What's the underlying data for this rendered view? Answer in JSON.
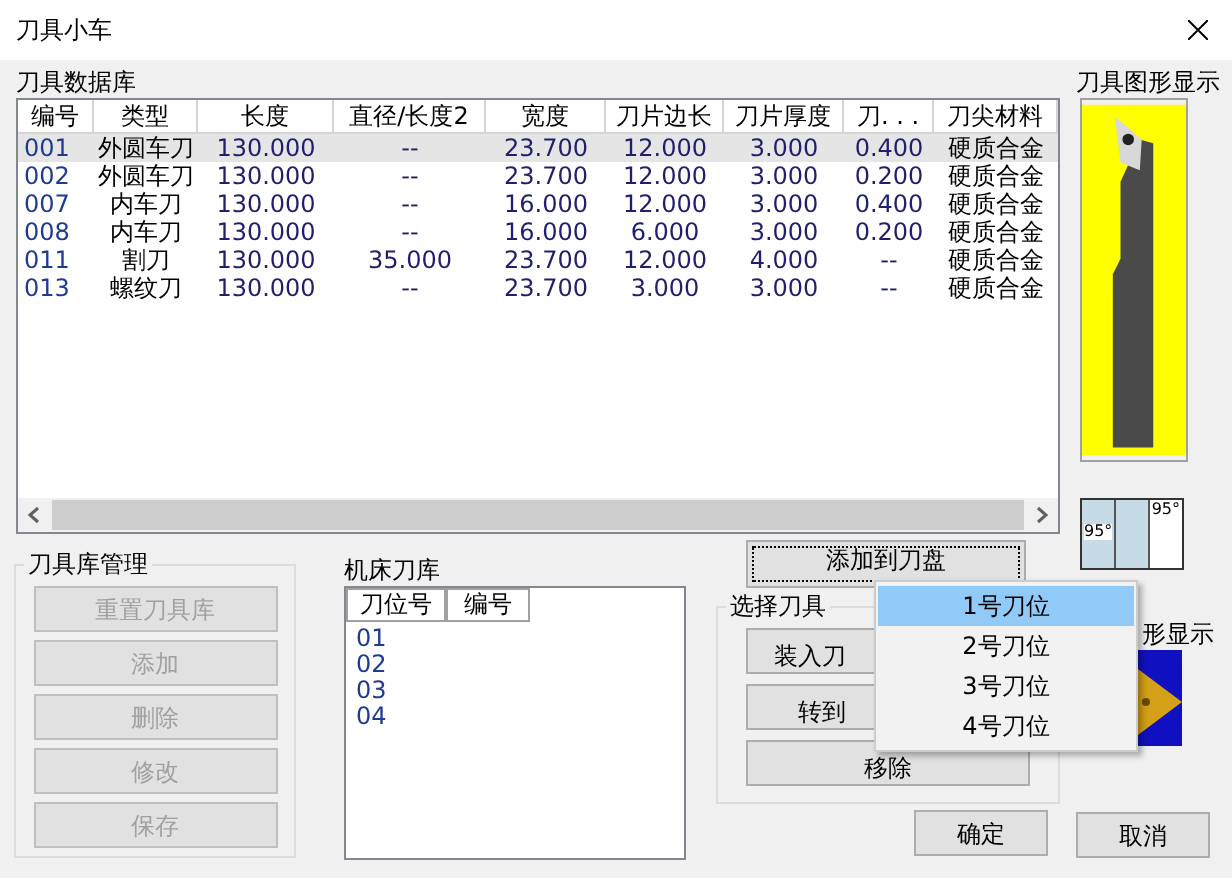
{
  "window": {
    "title": "刀具小车"
  },
  "tool_database": {
    "label": "刀具数据库",
    "columns": [
      "编号",
      "类型",
      "长度",
      "直径/长度2",
      "宽度",
      "刀片边长",
      "刀片厚度",
      "刀. . .",
      "刀尖材料"
    ],
    "rows": [
      {
        "cells": [
          "001",
          "外圆车刀",
          "130.000",
          "--",
          "23.700",
          "12.000",
          "3.000",
          "0.400",
          "硬质合金"
        ],
        "selected": true
      },
      {
        "cells": [
          "002",
          "外圆车刀",
          "130.000",
          "--",
          "23.700",
          "12.000",
          "3.000",
          "0.200",
          "硬质合金"
        ],
        "selected": false
      },
      {
        "cells": [
          "007",
          "内车刀",
          "130.000",
          "--",
          "16.000",
          "12.000",
          "3.000",
          "0.400",
          "硬质合金"
        ],
        "selected": false
      },
      {
        "cells": [
          "008",
          "内车刀",
          "130.000",
          "--",
          "16.000",
          "6.000",
          "3.000",
          "0.200",
          "硬质合金"
        ],
        "selected": false
      },
      {
        "cells": [
          "011",
          "割刀",
          "130.000",
          "35.000",
          "23.700",
          "12.000",
          "4.000",
          "--",
          "硬质合金"
        ],
        "selected": false
      },
      {
        "cells": [
          "013",
          "螺纹刀",
          "130.000",
          "--",
          "23.700",
          "3.000",
          "3.000",
          "--",
          "硬质合金"
        ],
        "selected": false
      }
    ]
  },
  "tool_preview": {
    "label": "刀具图形显示"
  },
  "holder_icon": {
    "angles": [
      "95°",
      "95°"
    ]
  },
  "insert_preview": {
    "label": "形显示"
  },
  "library_management": {
    "label": "刀具库管理",
    "buttons": [
      {
        "label": "重置刀具库",
        "disabled": true
      },
      {
        "label": "添加",
        "disabled": true
      },
      {
        "label": "删除",
        "disabled": true
      },
      {
        "label": "修改",
        "disabled": true
      },
      {
        "label": "保存",
        "disabled": true
      }
    ]
  },
  "machine_magazine": {
    "label": "机床刀库",
    "columns": [
      "刀位号",
      "编号"
    ],
    "rows": [
      "01",
      "02",
      "03",
      "04"
    ]
  },
  "add_button": "添加到刀盘",
  "select_tool": {
    "label": "选择刀具",
    "buttons": [
      "装入刀",
      "转到",
      "移除"
    ]
  },
  "context_menu": [
    {
      "label": "1号刀位",
      "selected": true
    },
    {
      "label": "2号刀位",
      "selected": false
    },
    {
      "label": "3号刀位",
      "selected": false
    },
    {
      "label": "4号刀位",
      "selected": false
    }
  ],
  "ok": "确定",
  "cancel": "取消"
}
